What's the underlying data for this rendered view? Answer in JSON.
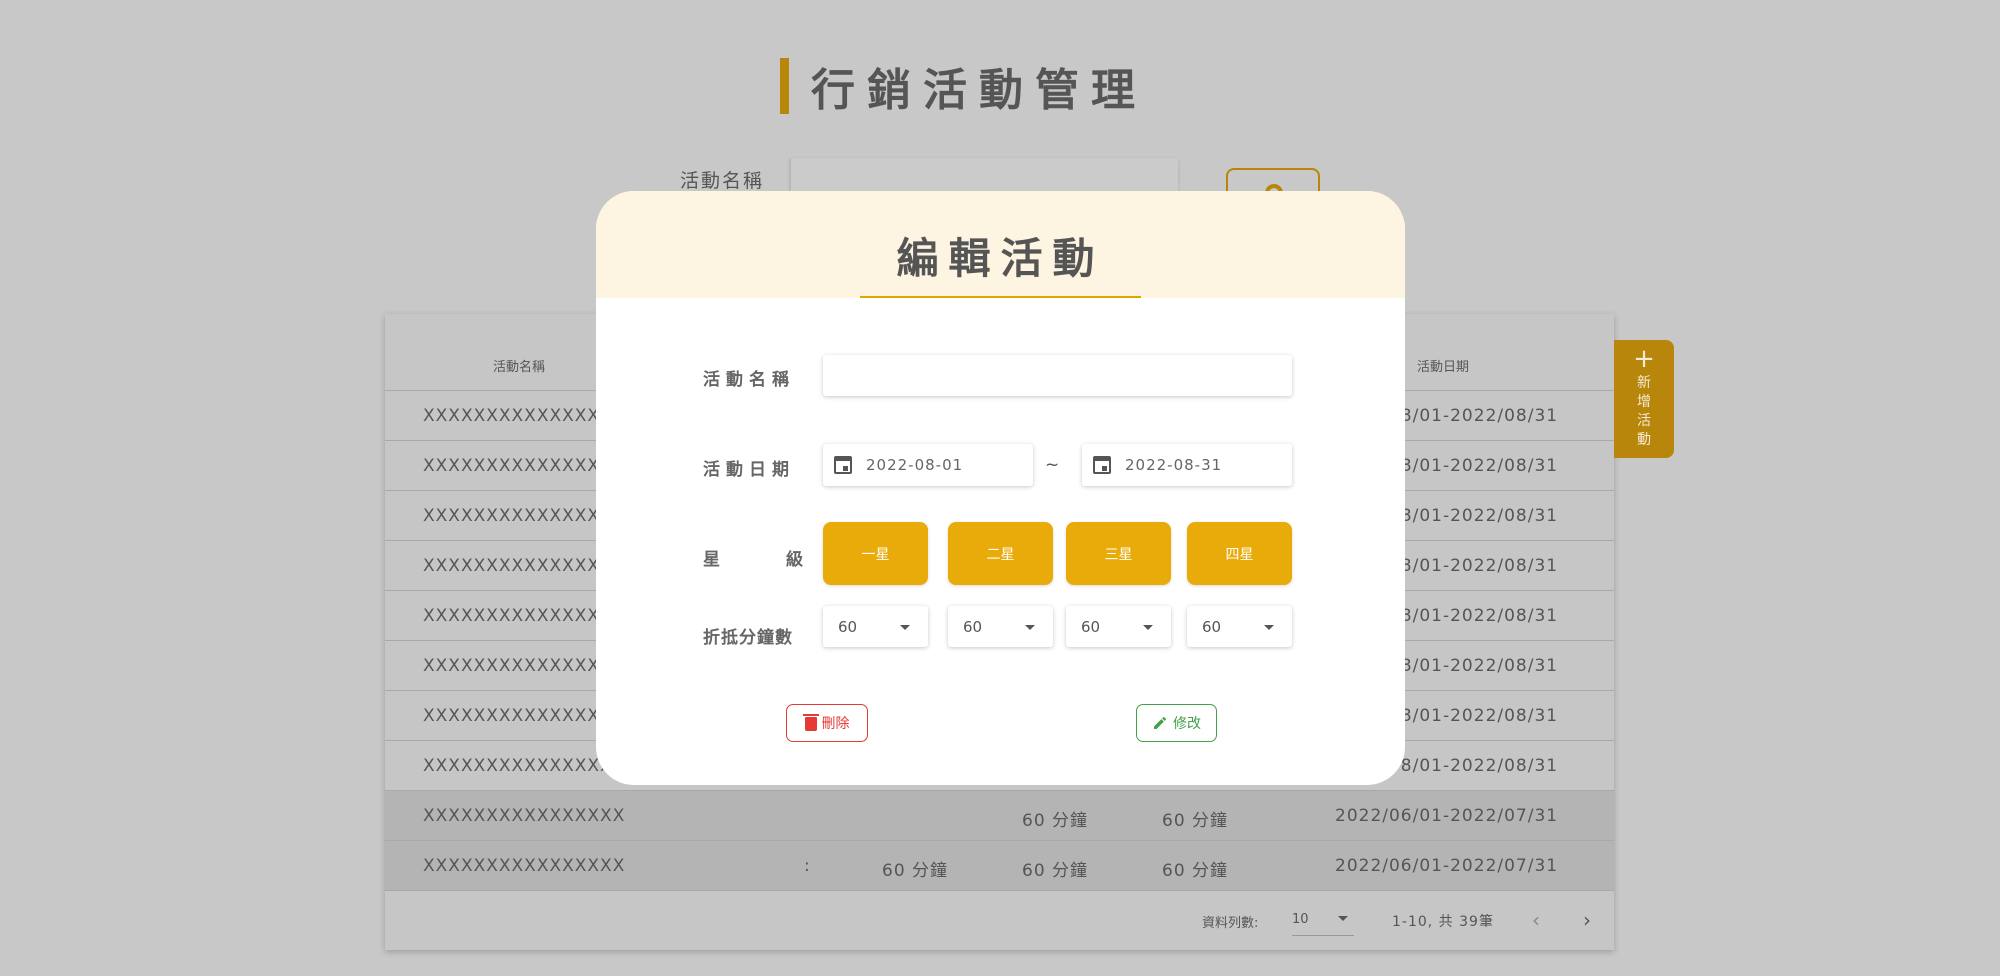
{
  "page": {
    "title": "行銷活動管理",
    "search_label": "活動名稱",
    "add_button_plus": "+",
    "add_button_label": "新增活動"
  },
  "table": {
    "headers": {
      "name": "活動名稱",
      "date": "活動日期"
    },
    "rows": [
      {
        "name": "XXXXXXXXXXXXXXXX",
        "date": "2022/08/01-2022/08/31",
        "m1": "",
        "m2": "",
        "m3": ""
      },
      {
        "name": "XXXXXXXXXXXXXXXX",
        "date": "2022/08/01-2022/08/31",
        "m1": "",
        "m2": "",
        "m3": ""
      },
      {
        "name": "XXXXXXXXXXXXXXXX",
        "date": "2022/08/01-2022/08/31",
        "m1": "",
        "m2": "",
        "m3": ""
      },
      {
        "name": "XXXXXXXXXXXXXXXX",
        "date": "2022/08/01-2022/08/31",
        "m1": "",
        "m2": "",
        "m3": ""
      },
      {
        "name": "XXXXXXXXXXXXXXXX",
        "date": "2022/08/01-2022/08/31",
        "m1": "",
        "m2": "",
        "m3": ""
      },
      {
        "name": "XXXXXXXXXXXXXXXX",
        "date": "2022/08/01-2022/08/31",
        "m1": "",
        "m2": "",
        "m3": ""
      },
      {
        "name": "XXXXXXXXXXXXXXXX",
        "date": "2022/08/01-2022/08/31",
        "m1": "",
        "m2": "",
        "m3": ""
      },
      {
        "name": "XXXXXXXXXXXXXXXX",
        "date": "2022/08/01-2022/08/31",
        "m1": "",
        "m2": "",
        "m3": ""
      },
      {
        "name": "XXXXXXXXXXXXXXXX",
        "date": "2022/06/01-2022/07/31",
        "m1": "",
        "m2": "60 分鐘",
        "m3": "60 分鐘"
      },
      {
        "name": "XXXXXXXXXXXXXXXX",
        "date": "2022/06/01-2022/07/31",
        "m1": "60 分鐘",
        "m2": "60 分鐘",
        "m3": "60 分鐘",
        "colon": ":"
      }
    ]
  },
  "pager": {
    "rows_label": "資料列數:",
    "rows_value": "10",
    "range": "1-10, 共 39筆",
    "prev": "‹",
    "next": "›"
  },
  "modal": {
    "title": "編輯活動",
    "labels": {
      "name": "活動名稱",
      "date": "活動日期",
      "star_left": "星",
      "star_right": "級",
      "discount": "折抵分鐘數"
    },
    "name_value": "",
    "date_start": "2022-08-01",
    "date_end": "2022-08-31",
    "date_separator": "~",
    "stars": [
      "一星",
      "二星",
      "三星",
      "四星"
    ],
    "discounts": [
      "60",
      "60",
      "60",
      "60"
    ],
    "delete_label": "刪除",
    "edit_label": "修改"
  },
  "colors": {
    "accent": "#e9ab0a",
    "accent_dark": "#b8860b",
    "modal_header": "#fdf5e2",
    "delete": "#e53935",
    "edit": "#43a047",
    "overlay_bg": "#c8c8c8"
  }
}
